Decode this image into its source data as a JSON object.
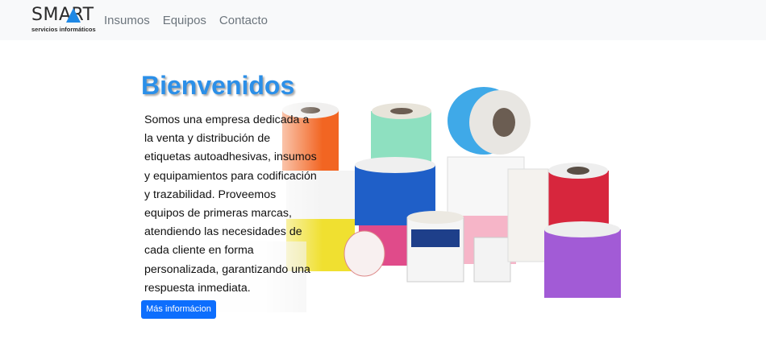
{
  "brand": {
    "name": "SMART",
    "tagline": "servicios informáticos",
    "accent": "#1e88e5"
  },
  "nav": {
    "items": [
      "Insumos",
      "Equipos",
      "Contacto"
    ]
  },
  "hero": {
    "title": "Bienvenidos",
    "description": "Somos una empresa dedicada a la venta y distribución de etiquetas autoadhesivas, insumos y equipamientos para codificación y trazabilidad. Proveemos equipos de primeras marcas, atendiendo las necesidades de cada cliente en forma personalizada, garantizando una respuesta inmediata.",
    "button_label": "Más informácion"
  },
  "colors": {
    "title": "#2b8fe8",
    "button": "#0d6efd",
    "navbar": "#f8f9fa"
  },
  "image": {
    "subject": "rolls-of-labels",
    "roll_colors": [
      "#f26522",
      "#8ee0c0",
      "#3fa9e8",
      "#1f5fc8",
      "#d7263d",
      "#e04b8a",
      "#f0e030",
      "#a25bd6",
      "#ffffff"
    ]
  }
}
